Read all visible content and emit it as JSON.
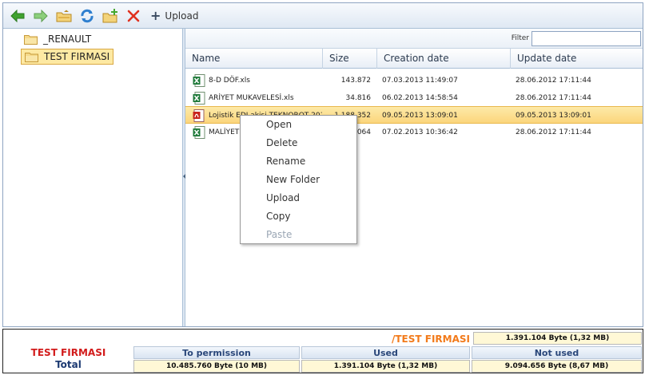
{
  "toolbar": {
    "buttons": [
      {
        "name": "back",
        "icon": "arrow-left-icon"
      },
      {
        "name": "forward",
        "icon": "arrow-right-icon"
      },
      {
        "name": "parent-folder",
        "icon": "folder-up-icon"
      },
      {
        "name": "refresh",
        "icon": "refresh-icon"
      },
      {
        "name": "new-folder",
        "icon": "folder-plus-icon"
      },
      {
        "name": "delete",
        "icon": "delete-x-icon"
      }
    ],
    "upload_label": "Upload"
  },
  "tree": {
    "items": [
      {
        "label": "_RENAULT",
        "selected": false
      },
      {
        "label": "TEST FIRMASI",
        "selected": true
      }
    ]
  },
  "filter": {
    "label": "Filter",
    "value": ""
  },
  "columns": {
    "name": "Name",
    "size": "Size",
    "created": "Creation date",
    "updated": "Update date"
  },
  "files": [
    {
      "name": "8-D DÖF.xls",
      "size": "143.872",
      "created": "07.03.2013 11:49:07",
      "updated": "28.06.2012 17:11:44",
      "type": "excel",
      "selected": false
    },
    {
      "name": "ARİYET MUKAVELESİ.xls",
      "size": "34.816",
      "created": "06.02.2013 14:58:54",
      "updated": "28.06.2012 17:11:44",
      "type": "excel",
      "selected": false
    },
    {
      "name": "Lojistik EDI akisi TEKNOROT 201",
      "size": "1.188.352",
      "created": "09.05.2013 13:09:01",
      "updated": "09.05.2013 13:09:01",
      "type": "pdf",
      "selected": true
    },
    {
      "name": "MALİYET",
      "size": "064",
      "created": "07.02.2013 10:36:42",
      "updated": "28.06.2012 17:11:44",
      "type": "excel",
      "selected": false
    }
  ],
  "context_menu": {
    "items": [
      {
        "label": "Open",
        "disabled": false
      },
      {
        "label": "Delete",
        "disabled": false
      },
      {
        "label": "Rename",
        "disabled": false
      },
      {
        "label": "New Folder",
        "disabled": false
      },
      {
        "label": "Upload",
        "disabled": false
      },
      {
        "label": "Copy",
        "disabled": false
      },
      {
        "label": "Paste",
        "disabled": true
      }
    ]
  },
  "footer": {
    "current_path": "/TEST FIRMASI",
    "current_size": "1.391.104 Byte (1,32 MB)",
    "company": "TEST FIRMASI",
    "total_label": "Total",
    "headers": {
      "permission": "To permission",
      "used": "Used",
      "not_used": "Not used"
    },
    "values": {
      "permission": "10.485.760 Byte (10 MB)",
      "used": "1.391.104 Byte (1,32 MB)",
      "not_used": "9.094.656 Byte (8,67 MB)"
    }
  },
  "colors": {
    "accent_orange": "#f27a1a",
    "company_red": "#d21b1b",
    "header_blue": "#2a477a",
    "selection": "#fbd57c"
  }
}
